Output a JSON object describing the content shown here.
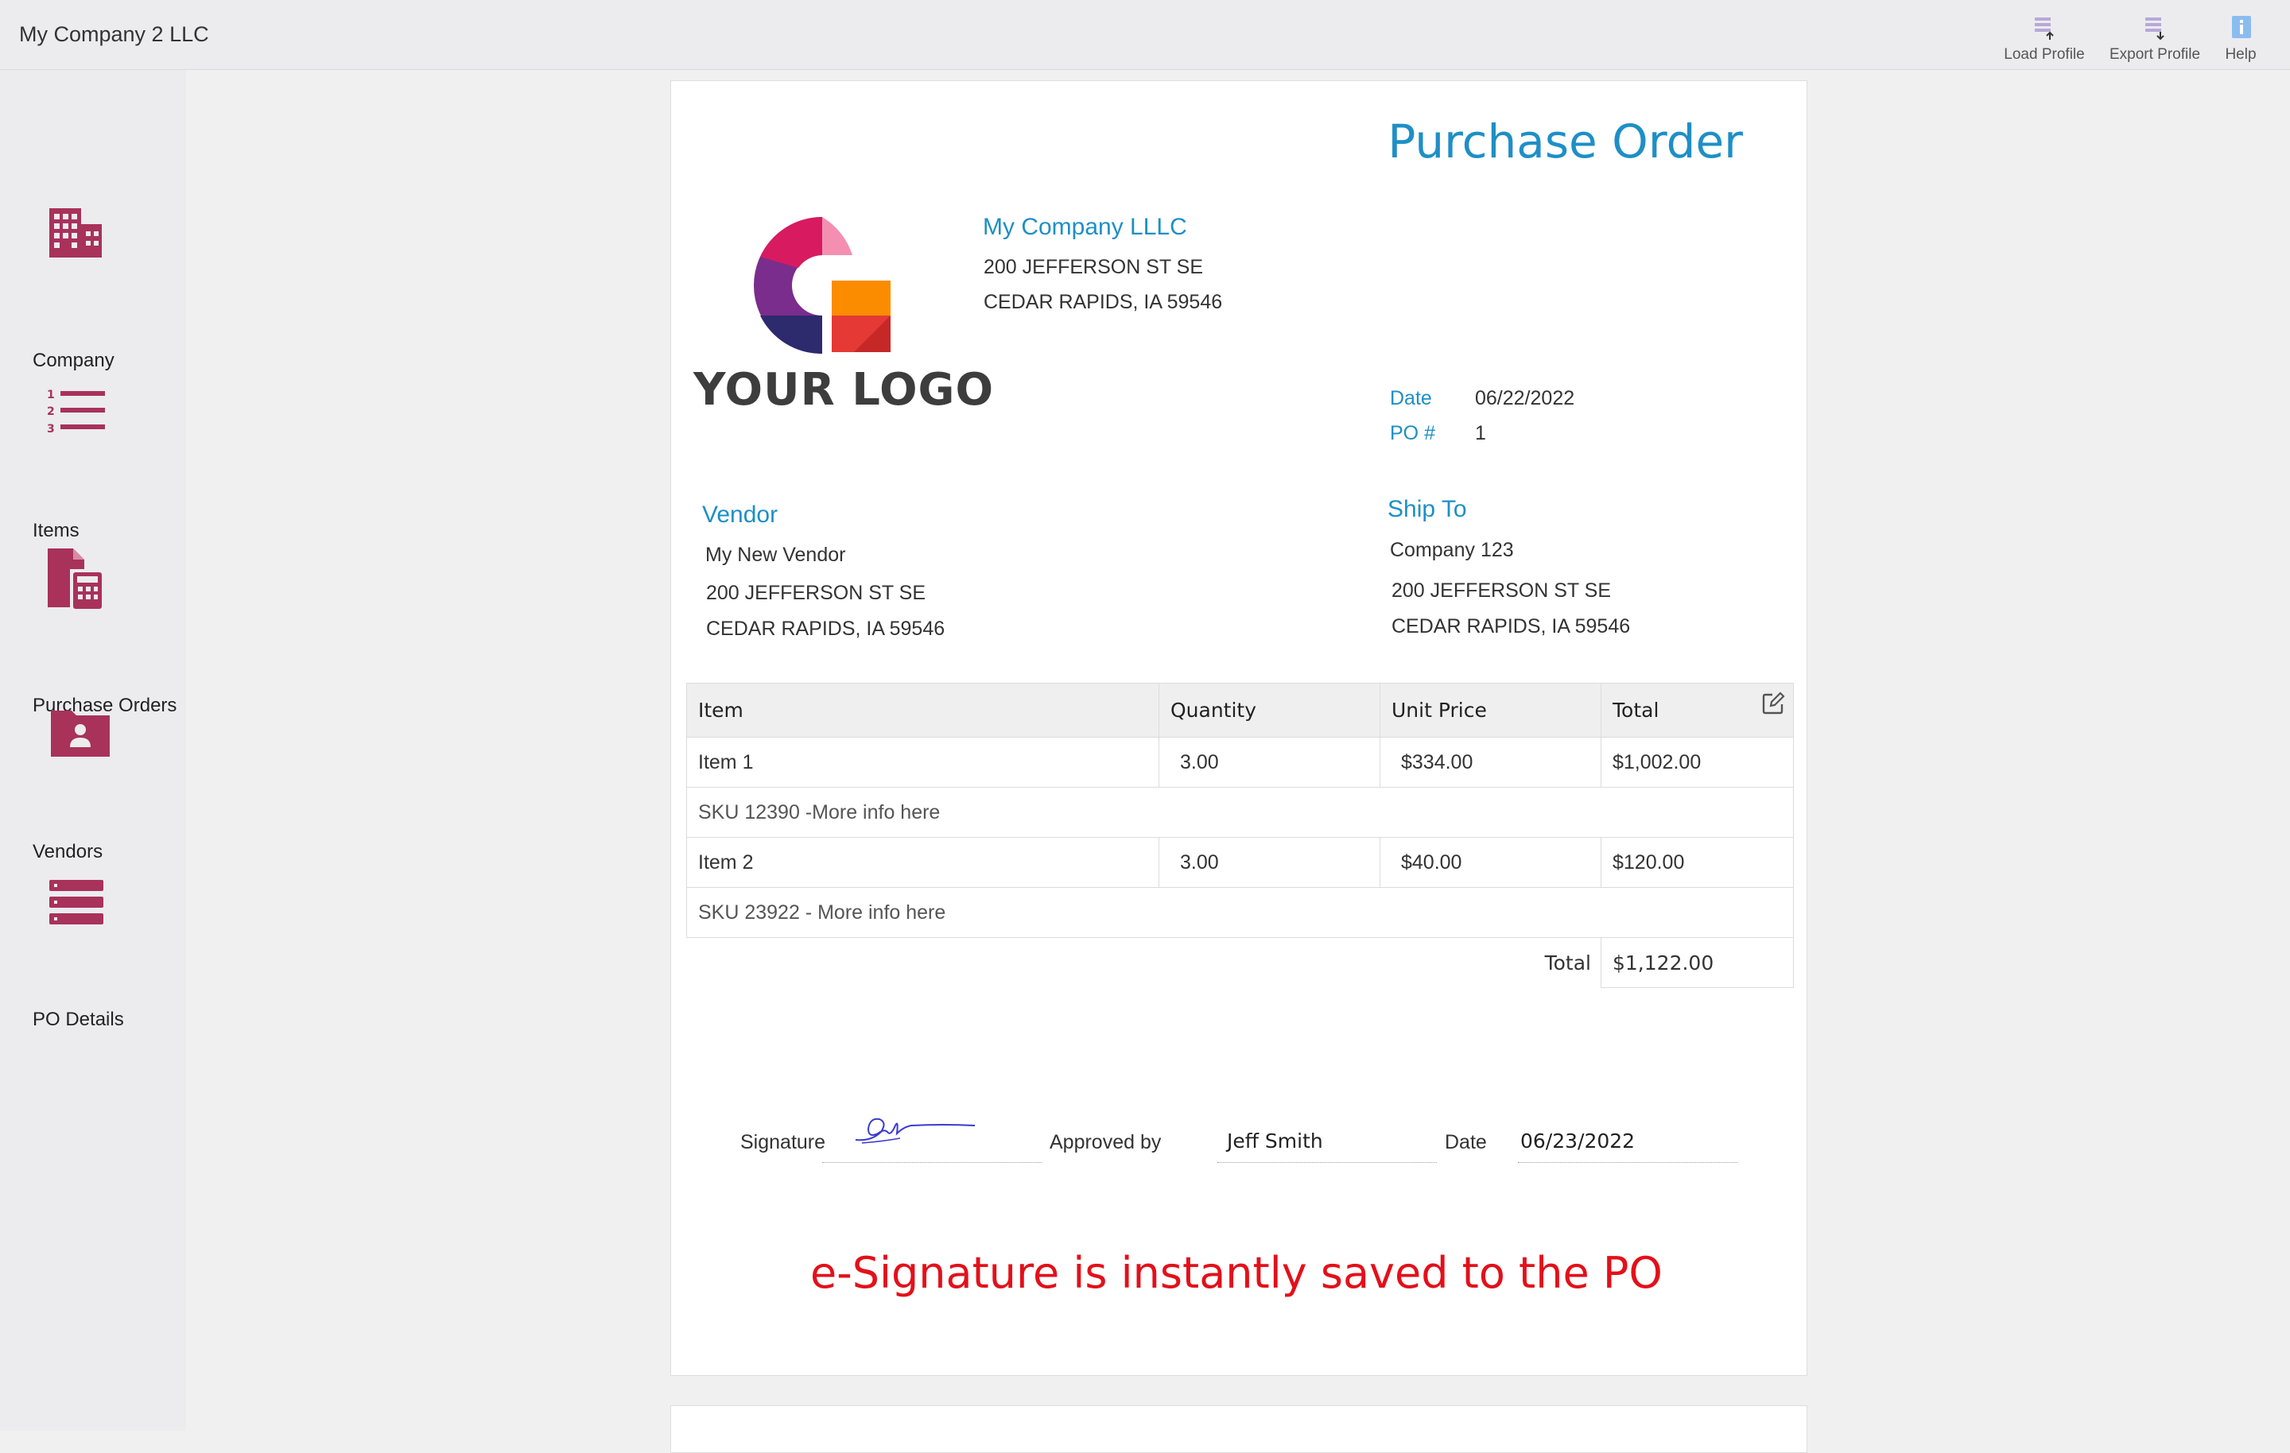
{
  "app": {
    "title": "My Company 2 LLC"
  },
  "toolbar": {
    "load_profile": "Load Profile",
    "export_profile": "Export Profile",
    "help": "Help"
  },
  "sidebar": {
    "items": [
      {
        "label": "Company",
        "icon": "building-icon"
      },
      {
        "label": "Items",
        "icon": "numbered-list-icon"
      },
      {
        "label": "Purchase Orders",
        "icon": "document-calculator-icon"
      },
      {
        "label": "Vendors",
        "icon": "contact-folder-icon"
      },
      {
        "label": "PO Details",
        "icon": "server-list-icon"
      }
    ],
    "accent": "#a8325a"
  },
  "document": {
    "title": "Purchase Order",
    "logo_text": "YOUR LOGO",
    "company": {
      "name": "My Company LLLC",
      "address1": "200 JEFFERSON ST SE",
      "address2": "CEDAR RAPIDS, IA 59546"
    },
    "meta": {
      "date_label": "Date",
      "date_value": "06/22/2022",
      "po_label": "PO #",
      "po_value": "1"
    },
    "vendor": {
      "heading": "Vendor",
      "name": "My New Vendor",
      "address1": "200 JEFFERSON ST SE",
      "address2": "CEDAR RAPIDS, IA 59546"
    },
    "ship_to": {
      "heading": "Ship To",
      "name": "Company 123",
      "address1": "200 JEFFERSON ST SE",
      "address2": "CEDAR RAPIDS, IA 59546"
    },
    "table": {
      "headers": {
        "item": "Item",
        "quantity": "Quantity",
        "unit_price": "Unit Price",
        "total": "Total"
      },
      "rows": [
        {
          "item": "Item 1",
          "quantity": "3.00",
          "unit_price": "$334.00",
          "total": "$1,002.00",
          "sku": "SKU 12390 -More info here"
        },
        {
          "item": "Item 2",
          "quantity": "3.00",
          "unit_price": "$40.00",
          "total": "$120.00",
          "sku": "SKU 23922 - More info here"
        }
      ],
      "total_label": "Total",
      "total_value": "$1,122.00"
    },
    "signature": {
      "signature_label": "Signature",
      "approved_label": "Approved by",
      "approved_value": "Jeff Smith",
      "date_label": "Date",
      "date_value": "06/23/2022"
    },
    "annotation": "e-Signature is instantly saved to the PO"
  },
  "colors": {
    "accent_blue": "#1e8fc6",
    "annotation_red": "#e3101a"
  }
}
